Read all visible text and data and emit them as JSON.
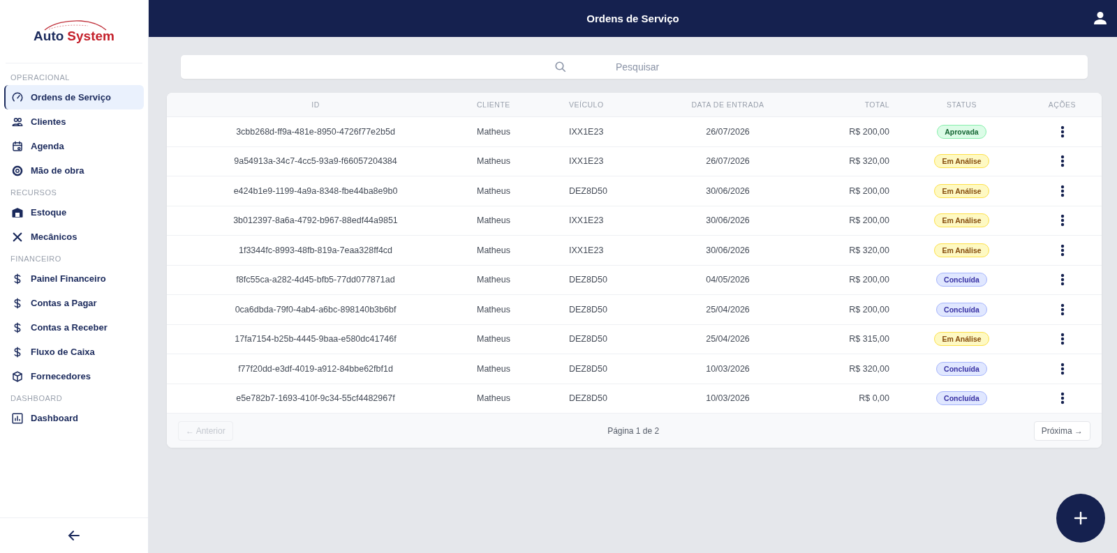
{
  "logo": {
    "word_1": "Auto",
    "word_2": "System"
  },
  "sidebar": {
    "sections": [
      {
        "title": "OPERACIONAL",
        "items": [
          {
            "label": "Ordens de Serviço",
            "selected": true
          },
          {
            "label": "Clientes",
            "selected": false
          },
          {
            "label": "Agenda",
            "selected": false
          },
          {
            "label": "Mão de obra",
            "selected": false
          }
        ]
      },
      {
        "title": "RECURSOS",
        "items": [
          {
            "label": "Estoque",
            "selected": false
          },
          {
            "label": "Mecânicos",
            "selected": false
          }
        ]
      },
      {
        "title": "FINANCEIRO",
        "items": [
          {
            "label": "Painel Financeiro",
            "selected": false
          },
          {
            "label": "Contas a Pagar",
            "selected": false
          },
          {
            "label": "Contas a Receber",
            "selected": false
          },
          {
            "label": "Fluxo de Caixa",
            "selected": false
          },
          {
            "label": "Fornecedores",
            "selected": false
          }
        ]
      },
      {
        "title": "DASHBOARD",
        "items": [
          {
            "label": "Dashboard",
            "selected": false
          }
        ]
      }
    ]
  },
  "header": {
    "title": "Ordens de Serviço"
  },
  "search": {
    "placeholder": "Pesquisar"
  },
  "table": {
    "columns": [
      "ID",
      "CLIENTE",
      "VEÍCULO",
      "DATA DE ENTRADA",
      "TOTAL",
      "STATUS",
      "AÇÕES"
    ],
    "rows": [
      {
        "id": "3cbb268d-ff9a-481e-8950-4726f77e2b5d",
        "client": "Matheus",
        "vehicle": "IXX1E23",
        "date": "26/07/2026",
        "total": "R$ 200,00",
        "status": "Aprovada",
        "kind": "approved"
      },
      {
        "id": "9a54913a-34c7-4cc5-93a9-f66057204384",
        "client": "Matheus",
        "vehicle": "IXX1E23",
        "date": "26/07/2026",
        "total": "R$ 320,00",
        "status": "Em Análise",
        "kind": "review"
      },
      {
        "id": "e424b1e9-1199-4a9a-8348-fbe44ba8e9b0",
        "client": "Matheus",
        "vehicle": "DEZ8D50",
        "date": "30/06/2026",
        "total": "R$ 200,00",
        "status": "Em Análise",
        "kind": "review"
      },
      {
        "id": "3b012397-8a6a-4792-b967-88edf44a9851",
        "client": "Matheus",
        "vehicle": "IXX1E23",
        "date": "30/06/2026",
        "total": "R$ 200,00",
        "status": "Em Análise",
        "kind": "review"
      },
      {
        "id": "1f3344fc-8993-48fb-819a-7eaa328ff4cd",
        "client": "Matheus",
        "vehicle": "IXX1E23",
        "date": "30/06/2026",
        "total": "R$ 320,00",
        "status": "Em Análise",
        "kind": "review"
      },
      {
        "id": "f8fc55ca-a282-4d45-bfb5-77dd077871ad",
        "client": "Matheus",
        "vehicle": "DEZ8D50",
        "date": "04/05/2026",
        "total": "R$ 200,00",
        "status": "Concluída",
        "kind": "done"
      },
      {
        "id": "0ca6dbda-79f0-4ab4-a6bc-898140b3b6bf",
        "client": "Matheus",
        "vehicle": "DEZ8D50",
        "date": "25/04/2026",
        "total": "R$ 200,00",
        "status": "Concluída",
        "kind": "done"
      },
      {
        "id": "17fa7154-b25b-4445-9baa-e580dc41746f",
        "client": "Matheus",
        "vehicle": "DEZ8D50",
        "date": "25/04/2026",
        "total": "R$ 315,00",
        "status": "Em Análise",
        "kind": "review"
      },
      {
        "id": "f77f20dd-e3df-4019-a912-84bbe62fbf1d",
        "client": "Matheus",
        "vehicle": "DEZ8D50",
        "date": "10/03/2026",
        "total": "R$ 320,00",
        "status": "Concluída",
        "kind": "done"
      },
      {
        "id": "e5e782b7-1693-410f-9c34-55cf4482967f",
        "client": "Matheus",
        "vehicle": "DEZ8D50",
        "date": "10/03/2026",
        "total": "R$ 0,00",
        "status": "Concluída",
        "kind": "done"
      }
    ]
  },
  "pagination": {
    "previous": {
      "label": "← Anterior",
      "disabled": true
    },
    "page": "Página 1 de 2",
    "next": {
      "label": "Próxima →",
      "disabled": false
    }
  }
}
